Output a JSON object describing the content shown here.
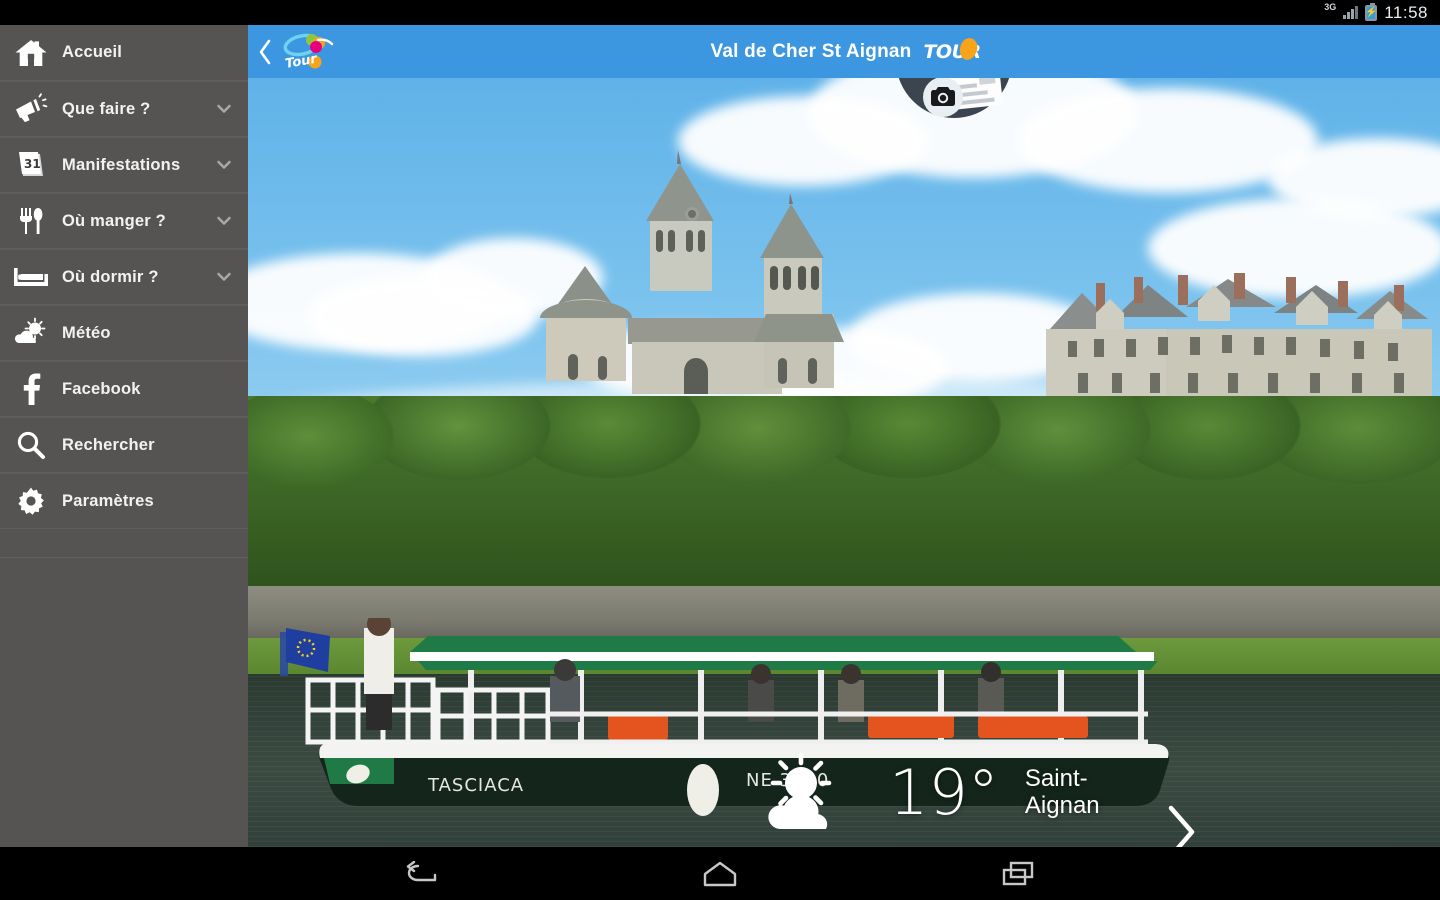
{
  "statusbar": {
    "network": "3G",
    "battery_icon": "battery-charging-icon",
    "signal_icon": "signal-bars-icon",
    "time": "11:58"
  },
  "sidebar": {
    "items": [
      {
        "id": "accueil",
        "label": "Accueil",
        "icon": "home-icon",
        "expandable": false
      },
      {
        "id": "que-faire",
        "label": "Que faire ?",
        "icon": "megaphone-icon",
        "expandable": true
      },
      {
        "id": "manifestations",
        "label": "Manifestations",
        "icon": "calendar-31-icon",
        "expandable": true
      },
      {
        "id": "ou-manger",
        "label": "Où manger ?",
        "icon": "cutlery-icon",
        "expandable": true
      },
      {
        "id": "ou-dormir",
        "label": "Où dormir ?",
        "icon": "bed-icon",
        "expandable": true
      },
      {
        "id": "meteo",
        "label": "Météo",
        "icon": "sun-cloud-icon",
        "expandable": false
      },
      {
        "id": "facebook",
        "label": "Facebook",
        "icon": "facebook-icon",
        "expandable": false
      },
      {
        "id": "rechercher",
        "label": "Rechercher",
        "icon": "search-icon",
        "expandable": false
      },
      {
        "id": "parametres",
        "label": "Paramètres",
        "icon": "gear-icon",
        "expandable": false
      }
    ],
    "background_color": "#555453"
  },
  "appbar": {
    "back_icon": "chevron-left-icon",
    "logo_icon": "tour-swoosh-logo",
    "logo_caption": "Tour",
    "title": "Val de Cher St Aignan",
    "badge_text": "TOUR",
    "background_color": "#3d97e0"
  },
  "hero": {
    "photo_alt": "Saint-Aignan church and chateau over the Cher river with a tour boat",
    "boat_name": "TASCIACA",
    "boat_registration": "NE 3120",
    "postcard_badge": {
      "icon": "camera-icon",
      "secondary_icon": "postcard-icon"
    }
  },
  "weather": {
    "condition_icon": "sun-behind-cloud-icon",
    "temperature": "19°",
    "city": "Saint-Aignan",
    "next_icon": "chevron-right-icon"
  },
  "navbar": {
    "back": "back-nav-icon",
    "home": "home-nav-icon",
    "recents": "recents-nav-icon"
  },
  "colors": {
    "accent_blue": "#3d97e0",
    "sidebar_gray": "#555453",
    "badge_orange": "#f7a419"
  }
}
